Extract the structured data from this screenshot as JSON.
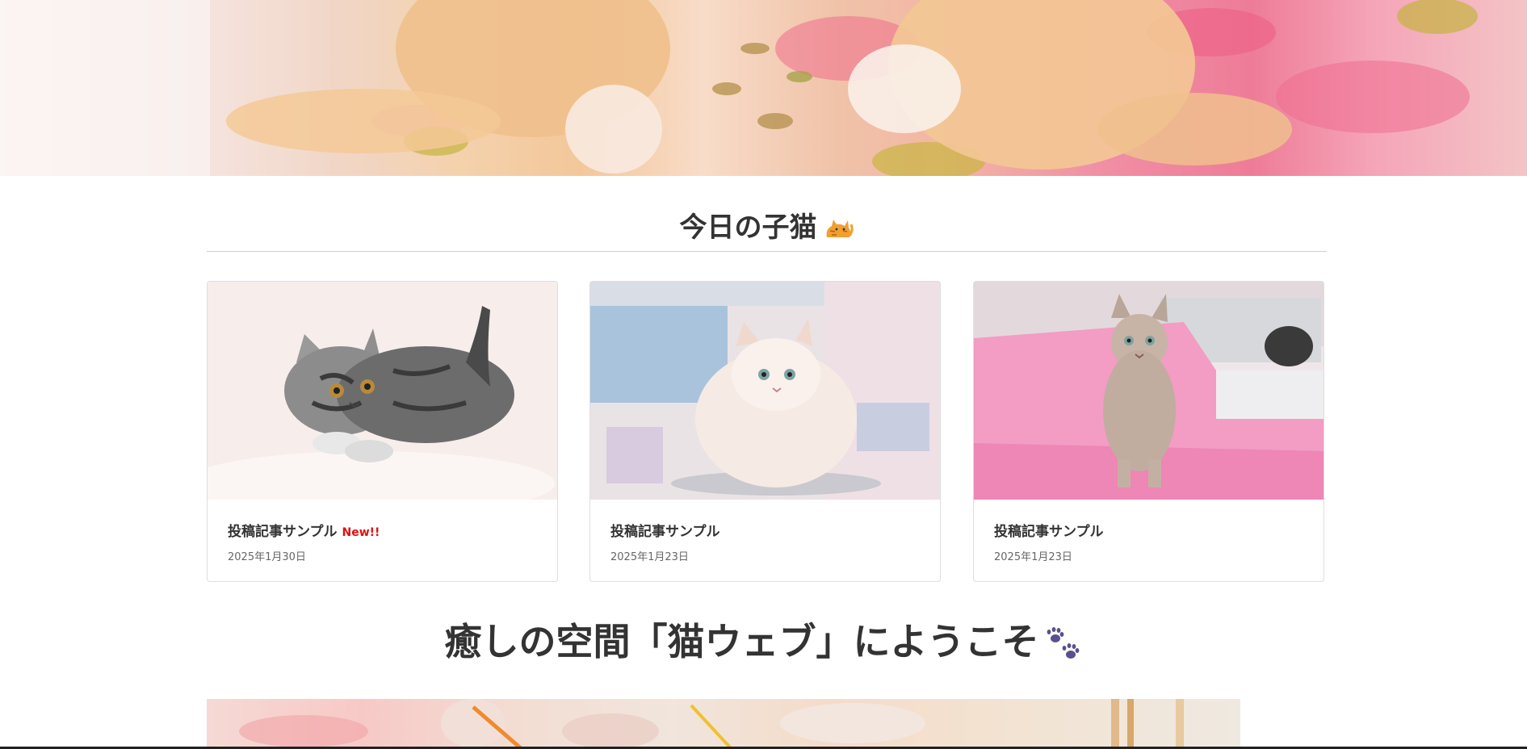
{
  "hero": {
    "image_label": "hero-kittens-image"
  },
  "section": {
    "title": "今日の子猫",
    "title_icon": "cat-emoji-icon"
  },
  "cards": [
    {
      "title": "投稿記事サンプル",
      "badge": "New!!",
      "date": "2025年1月30日",
      "image": "silver-tabby-kitten"
    },
    {
      "title": "投稿記事サンプル",
      "badge": "",
      "date": "2025年1月23日",
      "image": "white-persian-cat"
    },
    {
      "title": "投稿記事サンプル",
      "badge": "",
      "date": "2025年1月23日",
      "image": "singapura-cat-on-pink"
    }
  ],
  "welcome": {
    "heading": "癒しの空間「猫ウェブ」にようこそ",
    "icon": "paw-prints-icon"
  },
  "colors": {
    "badge_new": "#e01010",
    "text": "#333333",
    "rule": "#cfcfcf",
    "paw": "#5b4f8e"
  }
}
